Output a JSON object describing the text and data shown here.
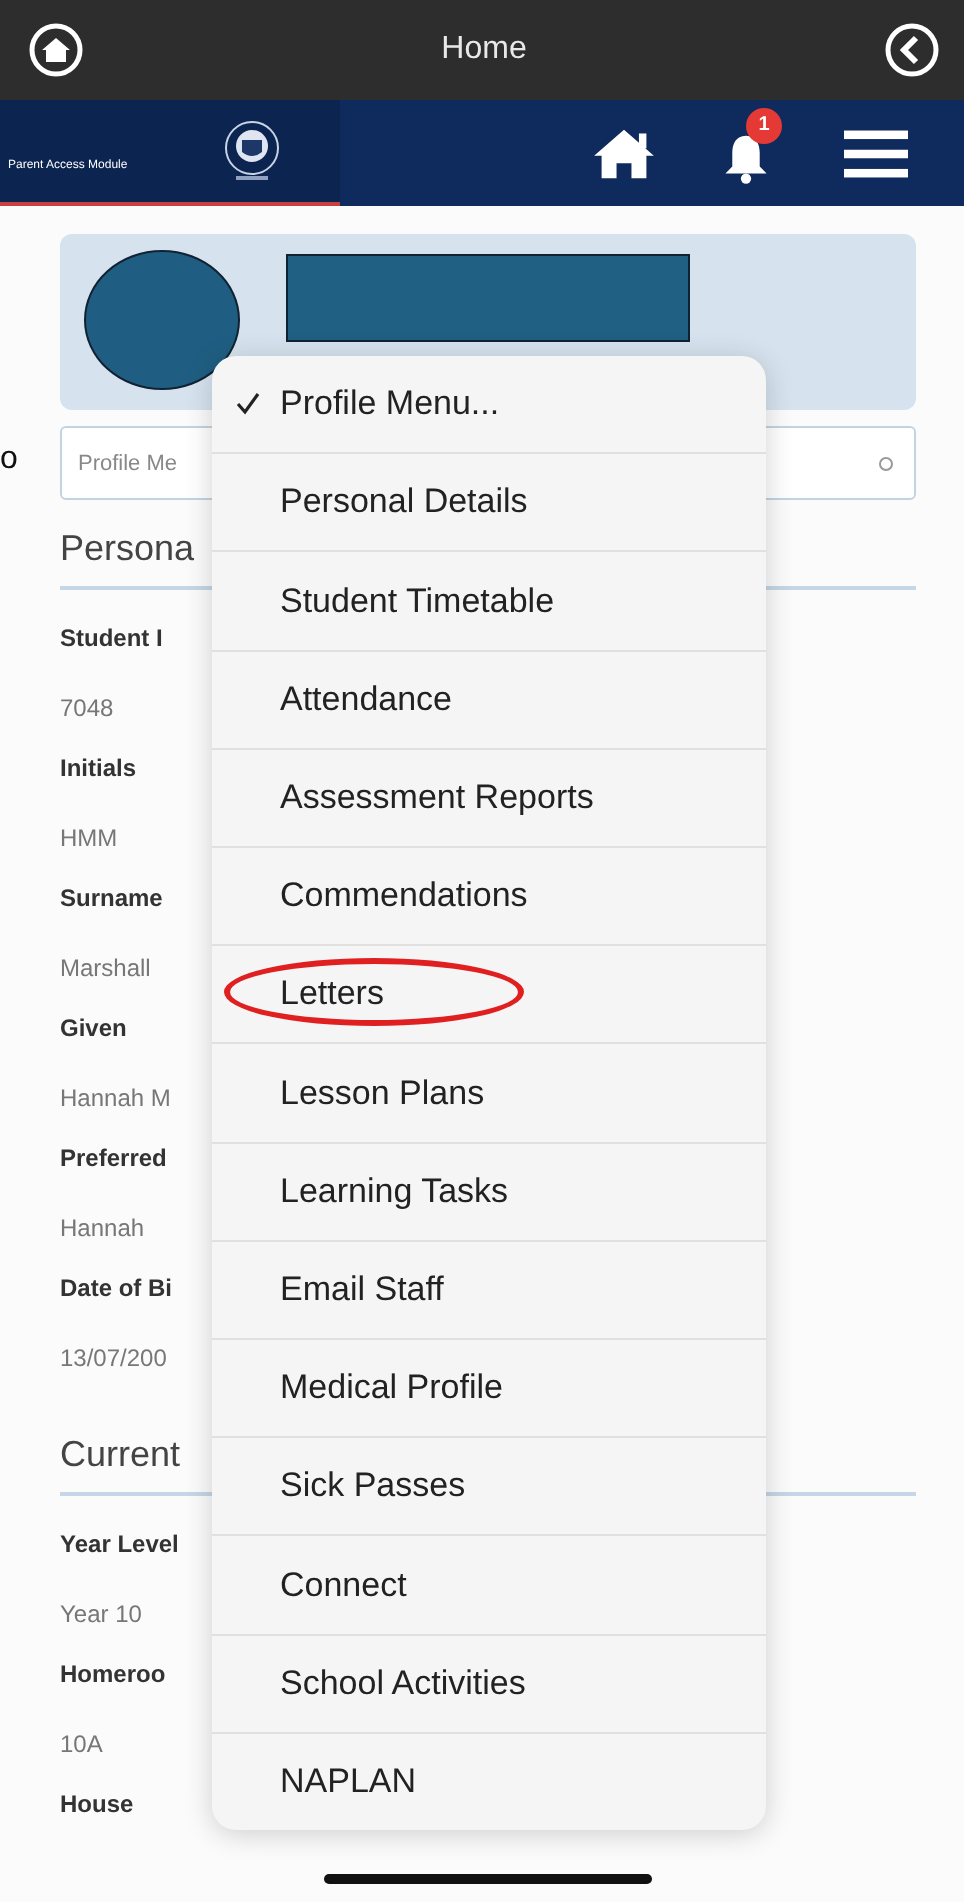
{
  "top_bar": {
    "title": "Home"
  },
  "header": {
    "brand": "Parent Access Module",
    "notification_count": "1"
  },
  "edge_text": "o",
  "profile_select": {
    "value": "Profile Me"
  },
  "sections": [
    {
      "heading": "Persona",
      "fields": [
        {
          "label": "Student I",
          "value": "7048"
        },
        {
          "label": "Initials",
          "value": "HMM"
        },
        {
          "label": "Surname",
          "value": "Marshall"
        },
        {
          "label": "Given",
          "value": "Hannah M"
        },
        {
          "label": "Preferred",
          "value": "Hannah"
        },
        {
          "label": "Date of Bi",
          "value": "13/07/200"
        }
      ]
    },
    {
      "heading": "Current",
      "fields": [
        {
          "label": "Year Level",
          "value": "Year 10"
        },
        {
          "label": "Homeroo",
          "value": "10A"
        },
        {
          "label": "House"
        }
      ]
    }
  ],
  "menu": {
    "items": [
      {
        "label": "Profile Menu...",
        "selected": true,
        "circled": false
      },
      {
        "label": "Personal Details",
        "selected": false,
        "circled": false
      },
      {
        "label": "Student Timetable",
        "selected": false,
        "circled": false
      },
      {
        "label": "Attendance",
        "selected": false,
        "circled": false
      },
      {
        "label": "Assessment Reports",
        "selected": false,
        "circled": false
      },
      {
        "label": "Commendations",
        "selected": false,
        "circled": false
      },
      {
        "label": "Letters",
        "selected": false,
        "circled": true
      },
      {
        "label": "Lesson Plans",
        "selected": false,
        "circled": false
      },
      {
        "label": "Learning Tasks",
        "selected": false,
        "circled": false
      },
      {
        "label": "Email Staff",
        "selected": false,
        "circled": false
      },
      {
        "label": "Medical Profile",
        "selected": false,
        "circled": false
      },
      {
        "label": "Sick Passes",
        "selected": false,
        "circled": false
      },
      {
        "label": "Connect",
        "selected": false,
        "circled": false
      },
      {
        "label": "School Activities",
        "selected": false,
        "circled": false
      },
      {
        "label": "NAPLAN",
        "selected": false,
        "circled": false
      }
    ]
  }
}
